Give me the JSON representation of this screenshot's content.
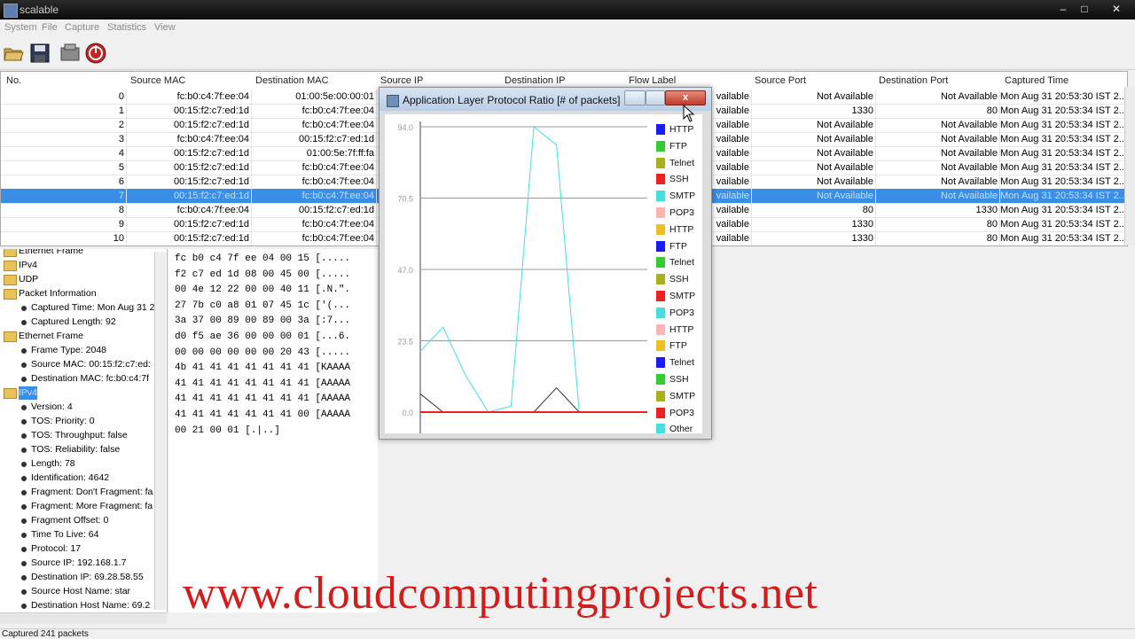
{
  "window": {
    "title": "scalable"
  },
  "menu": [
    "System",
    "File",
    "Capture",
    "Statistics",
    "View"
  ],
  "table": {
    "columns": [
      "No.",
      "Source MAC",
      "Destination MAC",
      "Source IP",
      "Destination IP",
      "Flow Label",
      "Source Port",
      "Destination Port",
      "Captured Time"
    ],
    "rows": [
      {
        "no": "0",
        "smac": "fc:b0:c4:7f:ee:04",
        "dmac": "01:00:5e:00:00:01",
        "fl": "vailable",
        "sp": "Not Available",
        "dp": "Not Available",
        "t": "Mon Aug 31 20:53:30 IST 2..."
      },
      {
        "no": "1",
        "smac": "00:15:f2:c7:ed:1d",
        "dmac": "fc:b0:c4:7f:ee:04",
        "fl": "vailable",
        "sp": "1330",
        "dp": "80",
        "t": "Mon Aug 31 20:53:34 IST 2..."
      },
      {
        "no": "2",
        "smac": "00:15:f2:c7:ed:1d",
        "dmac": "fc:b0:c4:7f:ee:04",
        "fl": "vailable",
        "sp": "Not Available",
        "dp": "Not Available",
        "t": "Mon Aug 31 20:53:34 IST 2..."
      },
      {
        "no": "3",
        "smac": "fc:b0:c4:7f:ee:04",
        "dmac": "00:15:f2:c7:ed:1d",
        "fl": "vailable",
        "sp": "Not Available",
        "dp": "Not Available",
        "t": "Mon Aug 31 20:53:34 IST 2..."
      },
      {
        "no": "4",
        "smac": "00:15:f2:c7:ed:1d",
        "dmac": "01:00:5e:7f:ff:fa",
        "fl": "vailable",
        "sp": "Not Available",
        "dp": "Not Available",
        "t": "Mon Aug 31 20:53:34 IST 2..."
      },
      {
        "no": "5",
        "smac": "00:15:f2:c7:ed:1d",
        "dmac": "fc:b0:c4:7f:ee:04",
        "fl": "vailable",
        "sp": "Not Available",
        "dp": "Not Available",
        "t": "Mon Aug 31 20:53:34 IST 2..."
      },
      {
        "no": "6",
        "smac": "00:15:f2:c7:ed:1d",
        "dmac": "fc:b0:c4:7f:ee:04",
        "fl": "vailable",
        "sp": "Not Available",
        "dp": "Not Available",
        "t": "Mon Aug 31 20:53:34 IST 2..."
      },
      {
        "no": "7",
        "smac": "00:15:f2:c7:ed:1d",
        "dmac": "fc:b0:c4:7f:ee:04",
        "fl": "vailable",
        "sp": "Not Available",
        "dp": "Not Available",
        "t": "Mon Aug 31 20:53:34 IST 2...",
        "selected": true
      },
      {
        "no": "8",
        "smac": "fc:b0:c4:7f:ee:04",
        "dmac": "00:15:f2:c7:ed:1d",
        "fl": "vailable",
        "sp": "80",
        "dp": "1330",
        "t": "Mon Aug 31 20:53:34 IST 2..."
      },
      {
        "no": "9",
        "smac": "00:15:f2:c7:ed:1d",
        "dmac": "fc:b0:c4:7f:ee:04",
        "fl": "vailable",
        "sp": "1330",
        "dp": "80",
        "t": "Mon Aug 31 20:53:34 IST 2..."
      },
      {
        "no": "10",
        "smac": "00:15:f2:c7:ed:1d",
        "dmac": "fc:b0:c4:7f:ee:04",
        "fl": "vailable",
        "sp": "1330",
        "dp": "80",
        "t": "Mon Aug 31 20:53:34 IST 2..."
      }
    ]
  },
  "tree": [
    {
      "label": "Ethernet Frame",
      "type": "folder",
      "level": 0
    },
    {
      "label": "IPv4",
      "type": "folder",
      "level": 0
    },
    {
      "label": "UDP",
      "type": "folder",
      "level": 0
    },
    {
      "label": "Packet Information",
      "type": "folder",
      "level": 0
    },
    {
      "label": "Captured Time: Mon Aug 31 2",
      "type": "leaf",
      "level": 1
    },
    {
      "label": "Captured Length: 92",
      "type": "leaf",
      "level": 1
    },
    {
      "label": "Ethernet Frame",
      "type": "folder",
      "level": 0
    },
    {
      "label": "Frame Type: 2048",
      "type": "leaf",
      "level": 1
    },
    {
      "label": "Source MAC: 00:15:f2:c7:ed:",
      "type": "leaf",
      "level": 1
    },
    {
      "label": "Destination MAC: fc:b0:c4:7f",
      "type": "leaf",
      "level": 1
    },
    {
      "label": "IPv4",
      "type": "folder",
      "level": 0,
      "selected": true
    },
    {
      "label": "Version: 4",
      "type": "leaf",
      "level": 1
    },
    {
      "label": "TOS: Priority: 0",
      "type": "leaf",
      "level": 1
    },
    {
      "label": "TOS: Throughput: false",
      "type": "leaf",
      "level": 1
    },
    {
      "label": "TOS: Reliability: false",
      "type": "leaf",
      "level": 1
    },
    {
      "label": "Length: 78",
      "type": "leaf",
      "level": 1
    },
    {
      "label": "Identification: 4642",
      "type": "leaf",
      "level": 1
    },
    {
      "label": "Fragment: Don't Fragment: fa",
      "type": "leaf",
      "level": 1
    },
    {
      "label": "Fragment: More Fragment: fa",
      "type": "leaf",
      "level": 1
    },
    {
      "label": "Fragment Offset: 0",
      "type": "leaf",
      "level": 1
    },
    {
      "label": "Time To Live: 64",
      "type": "leaf",
      "level": 1
    },
    {
      "label": "Protocol: 17",
      "type": "leaf",
      "level": 1
    },
    {
      "label": "Source IP: 192.168.1.7",
      "type": "leaf",
      "level": 1
    },
    {
      "label": "Destination IP: 69.28.58.55",
      "type": "leaf",
      "level": 1
    },
    {
      "label": "Source Host Name: star",
      "type": "leaf",
      "level": 1
    },
    {
      "label": "Destination Host Name: 69.2",
      "type": "leaf",
      "level": 1
    }
  ],
  "hex": [
    "fc b0 c4 7f ee 04 00 15 [.....",
    "f2 c7 ed 1d 08 00 45 00 [.....",
    "00 4e 12 22 00 00 40 11 [.N.\".",
    "27 7b c0 a8 01 07 45 1c ['(...",
    "3a 37 00 89 00 89 00 3a [:7...",
    "d0 f5 ae 36 00 00 00 01 [...6.",
    "00 00 00 00 00 00 20 43 [.....",
    "4b 41 41 41 41 41 41 41 [KAAAA",
    "41 41 41 41 41 41 41 41 [AAAAA",
    "41 41 41 41 41 41 41 41 [AAAAA",
    "41 41 41 41 41 41 41 00 [AAAAA",
    "00 21 00 01 [.|..]"
  ],
  "dialog": {
    "title": "Application Layer Protocol Ratio [# of packets]",
    "close_label": "x"
  },
  "chart_data": {
    "type": "line",
    "ylim": [
      0,
      94
    ],
    "yticks": [
      "94.0",
      "70.5",
      "47.0",
      "23.5",
      "0.0"
    ],
    "legend": [
      {
        "name": "HTTP",
        "color": "#1a1aff"
      },
      {
        "name": "FTP",
        "color": "#33cc33"
      },
      {
        "name": "Telnet",
        "color": "#a8b01e"
      },
      {
        "name": "SSH",
        "color": "#ee2020"
      },
      {
        "name": "SMTP",
        "color": "#44e0e0"
      },
      {
        "name": "POP3",
        "color": "#ffb3b3"
      },
      {
        "name": "HTTP",
        "color": "#f0c020"
      },
      {
        "name": "FTP",
        "color": "#1a1aff"
      },
      {
        "name": "Telnet",
        "color": "#33cc33"
      },
      {
        "name": "SSH",
        "color": "#a8b01e"
      },
      {
        "name": "SMTP",
        "color": "#ee2020"
      },
      {
        "name": "POP3",
        "color": "#44e0e0"
      },
      {
        "name": "HTTP",
        "color": "#ffb3b3"
      },
      {
        "name": "FTP",
        "color": "#f0c020"
      },
      {
        "name": "Telnet",
        "color": "#1a1aff"
      },
      {
        "name": "SSH",
        "color": "#33cc33"
      },
      {
        "name": "SMTP",
        "color": "#a8b01e"
      },
      {
        "name": "POP3",
        "color": "#ee2020"
      },
      {
        "name": "Other",
        "color": "#44e0e0"
      }
    ],
    "x": [
      0,
      1,
      2,
      3,
      4,
      5,
      6,
      7,
      8,
      9,
      10
    ],
    "series": [
      {
        "color": "#44e0e0",
        "values": [
          20,
          28,
          12,
          0,
          2,
          94,
          88,
          0,
          0,
          0,
          0
        ]
      },
      {
        "color": "#333333",
        "values": [
          6,
          0,
          0,
          0,
          0,
          0,
          8,
          0,
          0,
          0,
          0
        ]
      },
      {
        "color": "#ee2020",
        "values": [
          0,
          0,
          0,
          0,
          0,
          0,
          0,
          0,
          0,
          0,
          0
        ]
      }
    ]
  },
  "status": {
    "text": "Captured 241 packets"
  },
  "watermark": "www.cloudcomputingprojects.net"
}
